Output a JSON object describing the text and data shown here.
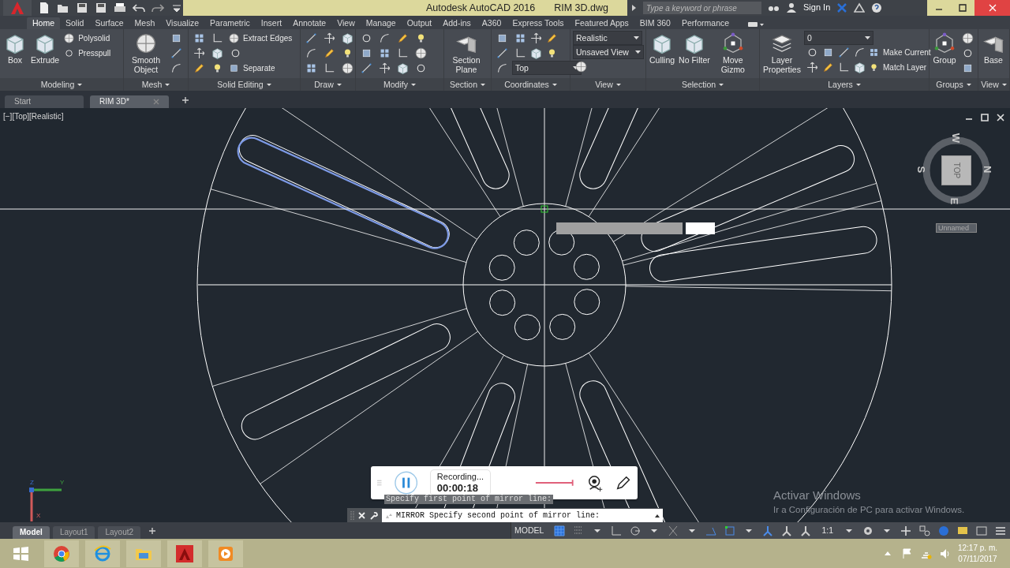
{
  "title_bar": {
    "app_title": "Autodesk AutoCAD 2016",
    "file_name": "RIM 3D.dwg",
    "search_placeholder": "Type a keyword or phrase",
    "sign_in": "Sign In"
  },
  "ribbon_tabs": [
    {
      "label": "Home",
      "selected": true
    },
    {
      "label": "Solid",
      "selected": false
    },
    {
      "label": "Surface",
      "selected": false
    },
    {
      "label": "Mesh",
      "selected": false
    },
    {
      "label": "Visualize",
      "selected": false
    },
    {
      "label": "Parametric",
      "selected": false
    },
    {
      "label": "Insert",
      "selected": false
    },
    {
      "label": "Annotate",
      "selected": false
    },
    {
      "label": "View",
      "selected": false
    },
    {
      "label": "Manage",
      "selected": false
    },
    {
      "label": "Output",
      "selected": false
    },
    {
      "label": "Add-ins",
      "selected": false
    },
    {
      "label": "A360",
      "selected": false
    },
    {
      "label": "Express Tools",
      "selected": false
    },
    {
      "label": "Featured Apps",
      "selected": false
    },
    {
      "label": "BIM 360",
      "selected": false
    },
    {
      "label": "Performance",
      "selected": false
    }
  ],
  "ribbon_panels": [
    {
      "title": "Modeling",
      "columns": [
        [
          {
            "kind": "large",
            "label": "Box"
          }
        ],
        [
          {
            "kind": "large",
            "label": "Extrude"
          }
        ],
        [
          {
            "kind": "small",
            "label": "Polysolid"
          },
          {
            "kind": "small",
            "label": "Presspull"
          }
        ]
      ]
    },
    {
      "title": "Mesh",
      "columns": [
        [
          {
            "kind": "large",
            "label": "Smooth Object"
          }
        ],
        [
          {
            "kind": "tool"
          },
          {
            "kind": "tool"
          },
          {
            "kind": "tool"
          }
        ]
      ]
    },
    {
      "title": "Solid Editing",
      "columns": [
        [
          {
            "kind": "tool"
          },
          {
            "kind": "tool"
          },
          {
            "kind": "tool"
          }
        ],
        [
          {
            "kind": "tool"
          },
          {
            "kind": "tool"
          },
          {
            "kind": "tool"
          }
        ],
        [
          {
            "kind": "small",
            "label": "Extract Edges"
          },
          {
            "kind": "tool"
          },
          {
            "kind": "small",
            "label": "Separate"
          }
        ]
      ]
    },
    {
      "title": "Draw",
      "columns": [
        [
          {
            "kind": "tool"
          },
          {
            "kind": "tool"
          },
          {
            "kind": "tool"
          }
        ],
        [
          {
            "kind": "tool"
          },
          {
            "kind": "tool"
          },
          {
            "kind": "tool"
          }
        ],
        [
          {
            "kind": "tool"
          },
          {
            "kind": "tool"
          },
          {
            "kind": "tool"
          }
        ]
      ]
    },
    {
      "title": "Modify",
      "columns": [
        [
          {
            "kind": "tool"
          },
          {
            "kind": "tool"
          },
          {
            "kind": "tool"
          }
        ],
        [
          {
            "kind": "tool"
          },
          {
            "kind": "tool"
          },
          {
            "kind": "tool"
          }
        ],
        [
          {
            "kind": "tool"
          },
          {
            "kind": "tool"
          },
          {
            "kind": "tool"
          }
        ],
        [
          {
            "kind": "tool"
          },
          {
            "kind": "tool"
          },
          {
            "kind": "tool"
          }
        ]
      ]
    },
    {
      "title": "Section",
      "columns": [
        [
          {
            "kind": "large",
            "label": "Section Plane"
          }
        ]
      ]
    },
    {
      "title": "Coordinates",
      "columns": [
        [
          {
            "kind": "tool"
          },
          {
            "kind": "tool"
          },
          {
            "kind": "tool"
          }
        ],
        [
          {
            "kind": "strip",
            "items": [
              {
                "kind": "tool"
              },
              {
                "kind": "tool"
              },
              {
                "kind": "tool"
              }
            ]
          },
          {
            "kind": "strip",
            "items": [
              {
                "kind": "tool"
              },
              {
                "kind": "tool"
              },
              {
                "kind": "tool"
              }
            ]
          },
          {
            "kind": "dropdown",
            "label": "Top"
          }
        ]
      ]
    },
    {
      "title": "View",
      "columns": [
        [
          {
            "kind": "dropdown",
            "label": "Realistic"
          },
          {
            "kind": "dropdown",
            "label": "Unsaved View"
          },
          {
            "kind": "tool"
          }
        ]
      ]
    },
    {
      "title": "Selection",
      "columns": [
        [
          {
            "kind": "large",
            "label": "Culling"
          }
        ],
        [
          {
            "kind": "large",
            "label": "No Filter"
          }
        ],
        [
          {
            "kind": "large",
            "label": "Move Gizmo"
          }
        ]
      ]
    },
    {
      "title": "Layers",
      "columns": [
        [
          {
            "kind": "large",
            "label": "Layer Properties"
          }
        ],
        [
          {
            "kind": "dropdown",
            "label": "0"
          },
          {
            "kind": "strip",
            "items": [
              {
                "kind": "tool"
              },
              {
                "kind": "tool"
              },
              {
                "kind": "tool"
              },
              {
                "kind": "tool"
              },
              {
                "kind": "small",
                "label": "Make Current"
              }
            ]
          },
          {
            "kind": "strip",
            "items": [
              {
                "kind": "tool"
              },
              {
                "kind": "tool"
              },
              {
                "kind": "tool"
              },
              {
                "kind": "tool"
              },
              {
                "kind": "small",
                "label": "Match Layer"
              }
            ]
          }
        ]
      ]
    },
    {
      "title": "Groups",
      "columns": [
        [
          {
            "kind": "large",
            "label": "Group"
          }
        ],
        [
          {
            "kind": "tool"
          },
          {
            "kind": "tool"
          },
          {
            "kind": "tool"
          }
        ]
      ]
    },
    {
      "title": "View",
      "columns": [
        [
          {
            "kind": "large",
            "label": "Base"
          }
        ]
      ]
    }
  ],
  "document_tabs": [
    {
      "label": "Start",
      "selected": false
    },
    {
      "label": "RIM 3D*",
      "selected": true
    }
  ],
  "viewport": {
    "label": "[−][Top][Realistic]",
    "viewcube": {
      "directions": [
        "W",
        "N",
        "E",
        "S"
      ],
      "face": "TOP",
      "ucs_menu": "Unnamed"
    },
    "ucs_axes": [
      "Z",
      "Y",
      "X"
    ]
  },
  "recorder": {
    "status": "Recording...",
    "elapsed": "00:00:18"
  },
  "command_line": {
    "history": "Specify first point of mirror line:",
    "prompt": "MIRROR Specify second point of mirror line:"
  },
  "activation_notice": {
    "title": "Activar Windows",
    "text": "Ir a Configuración de PC para activar Windows."
  },
  "layout_tabs": [
    {
      "label": "Model",
      "selected": true
    },
    {
      "label": "Layout1",
      "selected": false
    },
    {
      "label": "Layout2",
      "selected": false
    }
  ],
  "status_bar": {
    "space": "MODEL",
    "annotation_scale": "1:1"
  },
  "taskbar": {
    "time": "12:17 p. m.",
    "date": "07/11/2017"
  }
}
